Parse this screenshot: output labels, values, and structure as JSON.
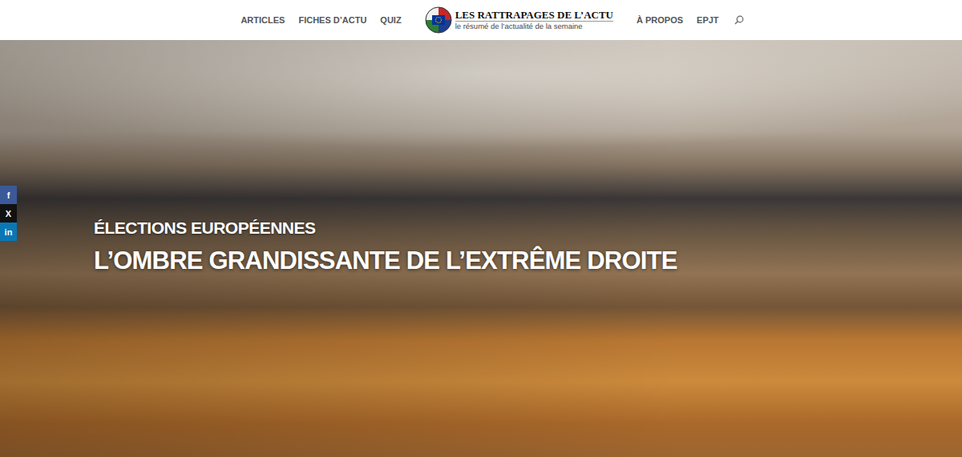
{
  "nav": {
    "left": [
      {
        "label": "ARTICLES"
      },
      {
        "label": "FICHES D’ACTU"
      },
      {
        "label": "QUIZ"
      }
    ],
    "right": [
      {
        "label": "À PROPOS"
      },
      {
        "label": "EPJT"
      }
    ]
  },
  "logo": {
    "title": "LES RATTRAPAGES DE L’ACTU",
    "tagline": "le résumé de l’actualité de la semaine"
  },
  "hero": {
    "kicker": "ÉLECTIONS EUROPÉENNES",
    "title": "L’OMBRE GRANDISSANTE DE L’EXTRÊME DROITE"
  },
  "share": [
    {
      "label": "f",
      "color": "#3b5998"
    },
    {
      "label": "X",
      "color": "#111111"
    },
    {
      "label": "in",
      "color": "#0a77b5"
    }
  ]
}
